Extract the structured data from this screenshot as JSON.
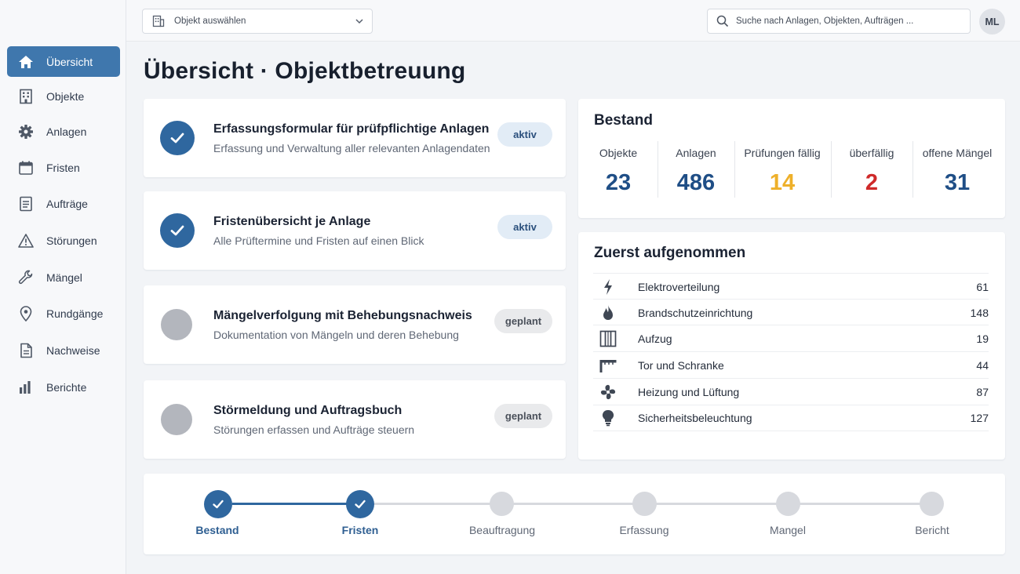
{
  "sidebar": {
    "items": [
      {
        "label": "Übersicht",
        "icon": "home-icon",
        "active": true
      },
      {
        "label": "Objekte",
        "icon": "building-icon"
      },
      {
        "label": "Anlagen",
        "icon": "gear-icon"
      },
      {
        "label": "Fristen",
        "icon": "calendar-icon"
      },
      {
        "label": "Aufträge",
        "icon": "document-list-icon"
      },
      {
        "label": "Störungen",
        "icon": "warning-icon"
      },
      {
        "label": "Mängel",
        "icon": "wrench-icon"
      },
      {
        "label": "Rundgänge",
        "icon": "map-pin-icon"
      },
      {
        "label": "Nachweise",
        "icon": "file-icon"
      },
      {
        "label": "Berichte",
        "icon": "bar-chart-icon"
      }
    ]
  },
  "topbar": {
    "object_select": "Objekt auswählen",
    "search_placeholder": "Suche nach Anlagen, Objekten, Aufträgen ...",
    "avatar": "ML"
  },
  "page_title": "Übersicht · Objektbetreuung",
  "features": [
    {
      "title": "Erfassungsformular für prüfpflichtige Anlagen",
      "desc": "Erfassung und Verwaltung aller relevanten Anlagendaten",
      "status": "aktiv",
      "done": true
    },
    {
      "title": "Fristenübersicht je Anlage",
      "desc": "Alle Prüftermine und Fristen auf einen Blick",
      "status": "aktiv",
      "done": true
    },
    {
      "title": "Mängelverfolgung mit Behebungsnachweis",
      "desc": "Dokumentation von Mängeln und deren Behebung",
      "status": "geplant",
      "done": false
    },
    {
      "title": "Störmeldung und Auftragsbuch",
      "desc": "Störungen erfassen und Aufträge steuern",
      "status": "geplant",
      "done": false
    }
  ],
  "bestand": {
    "title": "Bestand",
    "stats": [
      {
        "label": "Objekte",
        "value": "23",
        "color": "#1f4e86"
      },
      {
        "label": "Anlagen",
        "value": "486",
        "color": "#1f4e86"
      },
      {
        "label": "Prüfungen fällig",
        "value": "14",
        "color": "#eeb02a"
      },
      {
        "label": "überfällig",
        "value": "2",
        "color": "#cf2a2a"
      },
      {
        "label": "offene Mängel",
        "value": "31",
        "color": "#1f4e86"
      }
    ]
  },
  "zuerst": {
    "title": "Zuerst aufgenommen",
    "rows": [
      {
        "name": "Elektroverteilung",
        "count": "61",
        "icon": "lightning-icon"
      },
      {
        "name": "Brandschutzeinrichtung",
        "count": "148",
        "icon": "flame-icon"
      },
      {
        "name": "Aufzug",
        "count": "19",
        "icon": "elevator-icon"
      },
      {
        "name": "Tor und Schranke",
        "count": "44",
        "icon": "barrier-icon"
      },
      {
        "name": "Heizung und Lüftung",
        "count": "87",
        "icon": "fan-icon"
      },
      {
        "name": "Sicherheitsbeleuchtung",
        "count": "127",
        "icon": "lightbulb-icon"
      }
    ]
  },
  "steps": [
    {
      "label": "Bestand",
      "done": true
    },
    {
      "label": "Fristen",
      "done": true
    },
    {
      "label": "Beauftragung",
      "done": false
    },
    {
      "label": "Erfassung",
      "done": false
    },
    {
      "label": "Mangel",
      "done": false
    },
    {
      "label": "Bericht",
      "done": false
    }
  ],
  "colors": {
    "primary": "#2f679f",
    "sidebar_active": "#3f77ad",
    "warning": "#eeb02a",
    "danger": "#cf2a2a"
  }
}
